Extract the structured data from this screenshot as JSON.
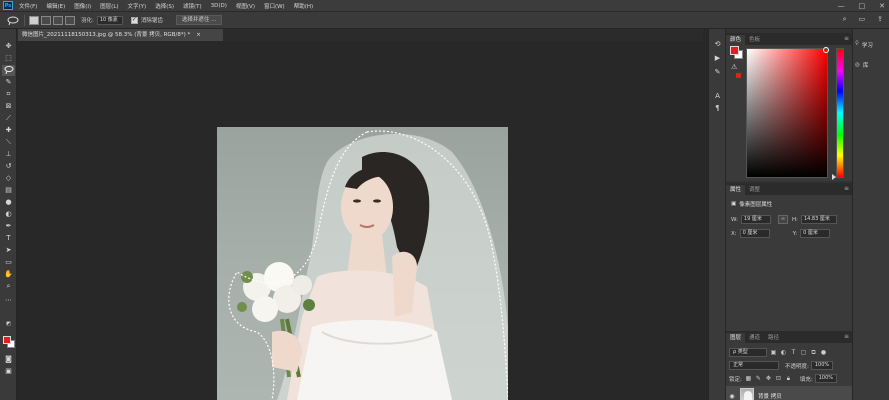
{
  "app": {
    "logo": "Ps"
  },
  "menu": [
    "文件(F)",
    "编辑(E)",
    "图像(I)",
    "图层(L)",
    "文字(Y)",
    "选择(S)",
    "滤镜(T)",
    "3D(D)",
    "视图(V)",
    "窗口(W)",
    "帮助(H)"
  ],
  "window_controls": [
    "—",
    "□",
    "✕"
  ],
  "options": {
    "feather_label": "羽化:",
    "feather_value": "10 像素",
    "antialias_label": "消除锯齿",
    "select_mask_button": "选择并遮住 ..."
  },
  "document": {
    "tab_title": "微信图片_20211118150313.jpg @ 58.3% (背景 拷贝, RGB/8*) *",
    "close": "×"
  },
  "color_panel": {
    "tabs": [
      "颜色",
      "色板"
    ],
    "foreground": "#e41e1e",
    "background": "#ffffff"
  },
  "properties_panel": {
    "tabs": [
      "属性",
      "调整"
    ],
    "title": "像素图层属性",
    "w_label": "W:",
    "w_value": "19 厘米",
    "h_label": "H:",
    "h_value": "14.83 厘米",
    "x_label": "X:",
    "x_value": "0 厘米",
    "y_label": "Y:",
    "y_value": "0 厘米",
    "link_icon": "∞"
  },
  "layers_panel": {
    "tabs": [
      "图层",
      "通道",
      "路径"
    ],
    "filter_kind": "ρ 类型",
    "blend_mode": "正常",
    "opacity_label": "不透明度:",
    "opacity_value": "100%",
    "lock_label": "锁定:",
    "fill_label": "填充:",
    "fill_value": "100%",
    "layer_name": "背景 拷贝"
  },
  "right_strip": {
    "items": [
      "学习",
      "库"
    ]
  },
  "panel_menu_icon": "≡"
}
